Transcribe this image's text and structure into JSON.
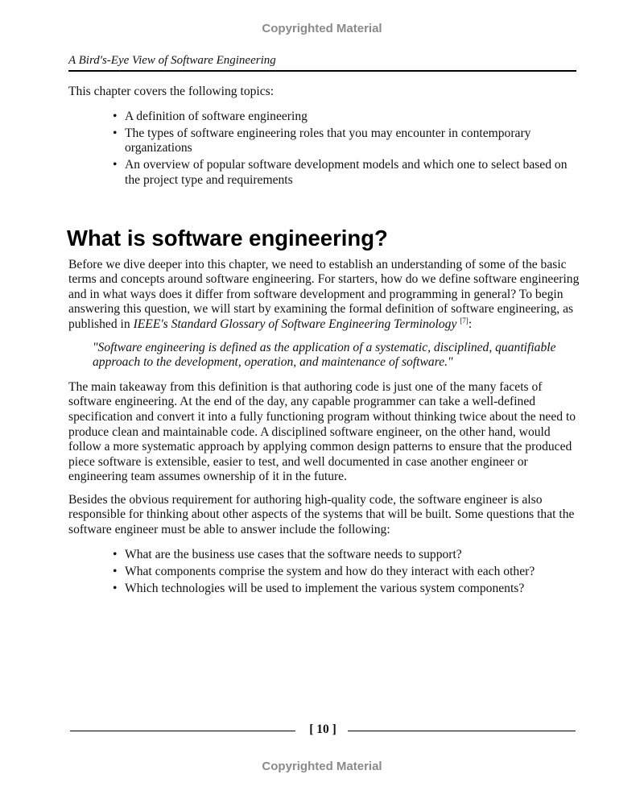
{
  "watermark": {
    "top": "Copyrighted Material",
    "bottom": "Copyrighted Material"
  },
  "running_header": "A Bird's-Eye View of Software Engineering",
  "intro": "This chapter covers the following topics:",
  "topics": [
    "A definition of software engineering",
    "The types of software engineering roles that you may encounter in contemporary organizations",
    "An overview of popular software development models and which one to select based on the project type and requirements"
  ],
  "section_title": "What is software engineering?",
  "para1": {
    "text": "Before we dive deeper into this chapter, we need to establish an understanding of some of the basic terms and concepts around software engineering. For starters, how do we define software engineering and in what ways does it differ from software development and programming in general? To begin answering this question, we will start by examining the formal definition of software engineering, as published in ",
    "source_title": "IEEE's Standard Glossary of Software Engineering Terminology",
    "citation": "[7]",
    "end": ":"
  },
  "definition_quote": "\"Software engineering is defined as the application of a systematic, disciplined, quantifiable approach to the development, operation, and maintenance of software.\"",
  "para2": "The main takeaway from this definition is that authoring code is just one of the many facets of software engineering. At the end of the day, any capable programmer can take a well-defined specification and convert it into a fully functioning program without thinking twice about the need to produce clean and maintainable code. A disciplined software engineer, on the other hand, would follow a more systematic approach by applying common design patterns to ensure that the produced piece software is extensible, easier to test, and well documented in case another engineer or engineering team assumes ownership of it in the future.",
  "para3": "Besides the obvious requirement for authoring high-quality code, the software engineer is also responsible for thinking about other aspects of the systems that will be built. Some questions that the software engineer must be able to answer include the following:",
  "questions": [
    "What are the business use cases that the software needs to support?",
    "What components comprise the system and how do they interact with each other?",
    "Which technologies will be used to implement the various system components?"
  ],
  "bullet_glyph": "•",
  "page_number": "[ 10 ]"
}
